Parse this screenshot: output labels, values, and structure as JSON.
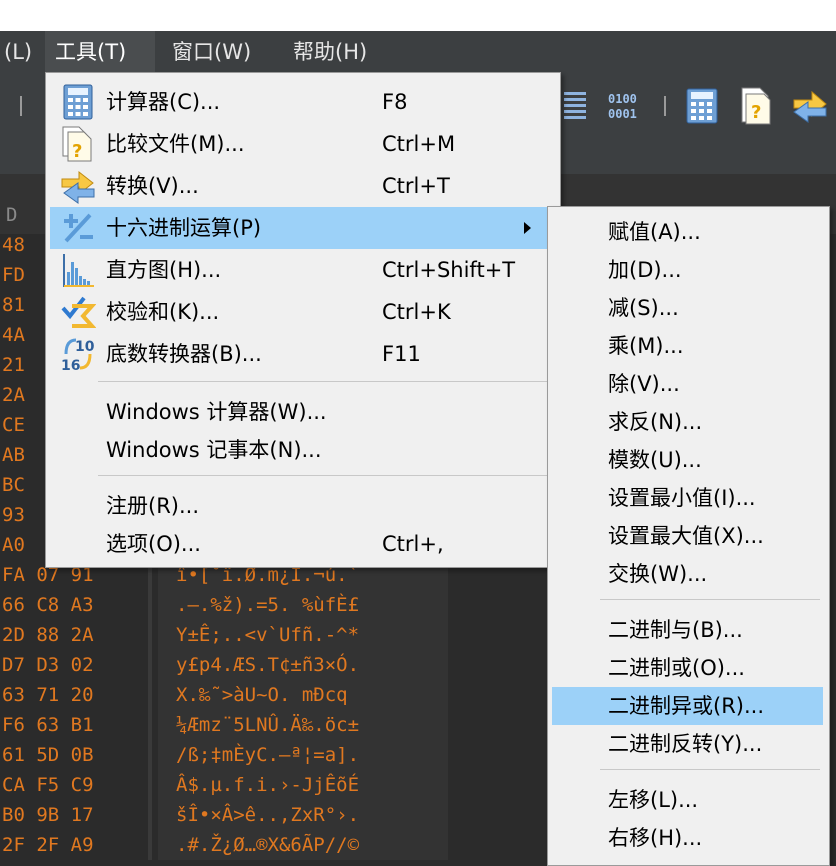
{
  "menubar": {
    "items": [
      {
        "label": "(L)"
      },
      {
        "label": "工具(T)"
      },
      {
        "label": "窗口(W)"
      },
      {
        "label": "帮助(H)"
      }
    ]
  },
  "hex": {
    "col_header": "D",
    "rows": [
      {
        "bytes": "48",
        "ascii": ""
      },
      {
        "bytes": "FD",
        "ascii": ""
      },
      {
        "bytes": "81",
        "ascii": ""
      },
      {
        "bytes": "4A",
        "ascii": ""
      },
      {
        "bytes": "21",
        "ascii": ""
      },
      {
        "bytes": "2A",
        "ascii": ""
      },
      {
        "bytes": "CE",
        "ascii": ""
      },
      {
        "bytes": "AB",
        "ascii": ""
      },
      {
        "bytes": "BC",
        "ascii": ""
      },
      {
        "bytes": "93",
        "ascii": ""
      },
      {
        "bytes": "A0",
        "ascii": ""
      },
      {
        "bytes": "FA 07 91",
        "ascii": "î•[˚ï.Ø.m¿Ï.¬ú.`"
      },
      {
        "bytes": "66 C8 A3",
        "ascii": ".–.%ž).=5. %ùfÈ£"
      },
      {
        "bytes": "2D 88 2A",
        "ascii": "Y±Ê;..<v`Ufñ.-^*"
      },
      {
        "bytes": "D7 D3 02",
        "ascii": "y£p4.ÆS.T¢±ñ3×Ó."
      },
      {
        "bytes": "63 71 20",
        "ascii": "X.‰˜>àU~O. mÐcq "
      },
      {
        "bytes": "F6 63 B1",
        "ascii": "¼Æmz¨5LNÛ.Ä‰.öc±"
      },
      {
        "bytes": "61 5D 0B",
        "ascii": "/ß;‡mÈyC.–ª¦=a]."
      },
      {
        "bytes": "CA F5 C9",
        "ascii": "Â$.µ.f.i.›-JjÊõÉ"
      },
      {
        "bytes": "B0 9B 17",
        "ascii": "šÎ•×Â>ê..,ZxR°›."
      },
      {
        "bytes": "2F 2F A9",
        "ascii": ".#.Ž¿Ø…®X&6ÃP//©"
      }
    ]
  },
  "tools_menu": {
    "items": [
      {
        "label": "计算器(C)...",
        "shortcut": "F8",
        "icon": "calculator-icon"
      },
      {
        "label": "比较文件(M)...",
        "shortcut": "Ctrl+M",
        "icon": "compare-files-icon"
      },
      {
        "label": "转换(V)...",
        "shortcut": "Ctrl+T",
        "icon": "convert-icon"
      },
      {
        "label": "十六进制运算(P)",
        "shortcut": "",
        "icon": "hex-operation-icon"
      },
      {
        "label": "直方图(H)...",
        "shortcut": "Ctrl+Shift+T",
        "icon": "histogram-icon"
      },
      {
        "label": "校验和(K)...",
        "shortcut": "Ctrl+K",
        "icon": "checksum-icon"
      },
      {
        "label": "底数转换器(B)...",
        "shortcut": "F11",
        "icon": "base-converter-icon"
      },
      {
        "label": "Windows 计算器(W)...",
        "shortcut": ""
      },
      {
        "label": "Windows 记事本(N)...",
        "shortcut": ""
      },
      {
        "label": "注册(R)...",
        "shortcut": ""
      },
      {
        "label": "选项(O)...",
        "shortcut": "Ctrl+,"
      }
    ]
  },
  "hex_submenu": {
    "items": [
      {
        "label": "赋值(A)..."
      },
      {
        "label": "加(D)..."
      },
      {
        "label": "减(S)..."
      },
      {
        "label": "乘(M)..."
      },
      {
        "label": "除(V)..."
      },
      {
        "label": "求反(N)..."
      },
      {
        "label": "模数(U)..."
      },
      {
        "label": "设置最小值(I)..."
      },
      {
        "label": "设置最大值(X)..."
      },
      {
        "label": "交换(W)..."
      },
      {
        "label": "二进制与(B)..."
      },
      {
        "label": "二进制或(O)..."
      },
      {
        "label": "二进制异或(R)..."
      },
      {
        "label": "二进制反转(Y)..."
      },
      {
        "label": "左移(L)..."
      },
      {
        "label": "右移(H)..."
      }
    ]
  },
  "colors": {
    "highlight": "#9cd1f8",
    "hex_text": "#e07820",
    "menu_bg": "#f0f0f0"
  }
}
